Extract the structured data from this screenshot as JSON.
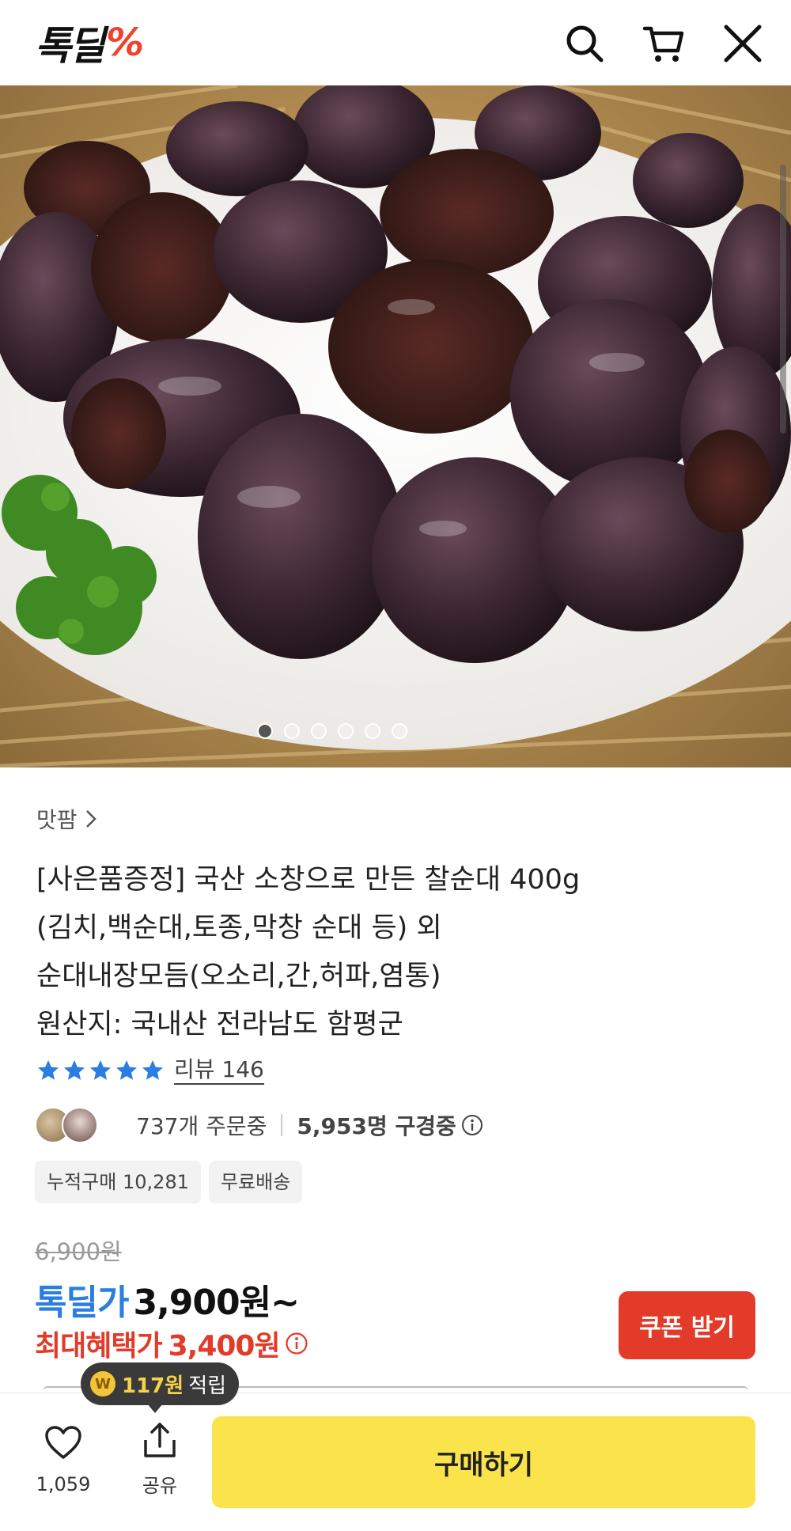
{
  "header": {
    "logo_text": "톡딜",
    "logo_mark": "%",
    "icons": [
      "search-icon",
      "cart-icon",
      "close-icon"
    ]
  },
  "gallery": {
    "image_count": 6,
    "active_index": 0
  },
  "product": {
    "seller": "맛팜",
    "title_lines": [
      "[사은품증정] 국산 소창으로 만든 찰순대 400g",
      "(김치,백순대,토종,막창 순대 등) 외",
      "순대내장모듬(오소리,간,허파,염통)",
      "원산지: 국내산 전라남도 함평군"
    ],
    "rating_stars": 5,
    "review_label": "리뷰 146",
    "orders_text": "737개 주문중",
    "browsing_text": "5,953명 구경중",
    "tags": [
      "누적구매 10,281",
      "무료배송"
    ]
  },
  "pricing": {
    "original_price": "6,900원",
    "deal_label": "톡딜가",
    "deal_price": "3,900원~",
    "benefit_label": "최대혜택가",
    "benefit_price": "3,400원",
    "coupon_button": "쿠폰 받기"
  },
  "bottom": {
    "favorite_count": "1,059",
    "share_label": "공유",
    "buy_button": "구매하기",
    "tooltip_coin": "W",
    "tooltip_amount": "117원",
    "tooltip_label": "적립"
  },
  "colors": {
    "accent_blue": "#2a7de1",
    "accent_red": "#e23b2a",
    "buy_yellow": "#fbe44b",
    "logo_red": "#f2422e"
  }
}
